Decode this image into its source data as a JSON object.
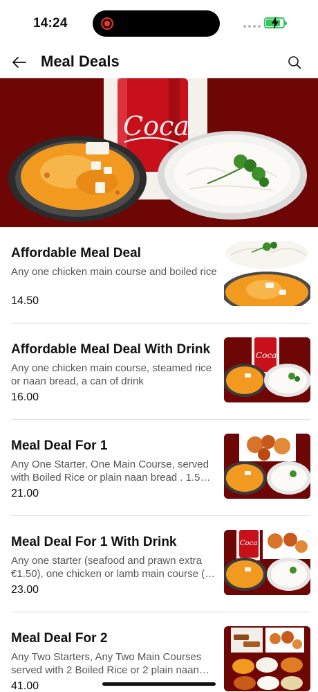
{
  "status_bar": {
    "time": "14:24",
    "battery_color": "#34c759",
    "record_indicator_color": "#ef3b2d"
  },
  "header": {
    "title": "Meal Deals",
    "back_icon": "arrow-left-icon",
    "search_icon": "search-icon"
  },
  "hero": {
    "image": "hero-banner-meal-deal"
  },
  "theme": {
    "brand_maroon": "#6e0606",
    "divider": "#dcdcdc"
  },
  "items": [
    {
      "name": "Affordable Meal Deal",
      "description": "Any one chicken main course and boiled rice",
      "price": "14.50",
      "thumb": "curry-and-rice"
    },
    {
      "name": "Affordable Meal Deal With Drink",
      "description": "Any one chicken main course, steamed rice or naan bread, a can of drink",
      "price": "16.00",
      "thumb": "curry-rice-coke"
    },
    {
      "name": "Meal Deal For 1",
      "description": "Any One Starter, One Main Course, served with Boiled Rice or  plain naan bread . 1.5…",
      "price": "21.00",
      "thumb": "starter-curry-rice"
    },
    {
      "name": "Meal Deal For 1 With Drink",
      "description": "Any one starter (seafood and prawn extra €1.50), one chicken or lamb main course (…",
      "price": "23.00",
      "thumb": "starter-curry-rice-coke"
    },
    {
      "name": "Meal Deal For 2",
      "description": "Any Two Starters, Any Two Main Courses served with 2 Boiled Rice or 2 plain naan…",
      "price": "41.00",
      "thumb": "meal-for-two-platter"
    }
  ]
}
